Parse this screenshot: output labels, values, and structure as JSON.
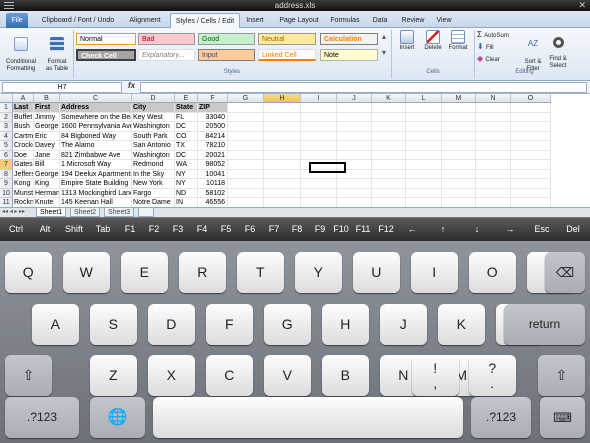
{
  "window": {
    "title": "address.xls"
  },
  "tabs": [
    "File",
    "Clipboard / Font / Undo",
    "Alignment",
    "Styles / Cells / Edit",
    "Insert",
    "Page Layout",
    "Formulas",
    "Data",
    "Review",
    "View"
  ],
  "ribbon": {
    "conditional": "Conditional\nFormatting",
    "format_table": "Format\nas Table",
    "styles": [
      "Normal",
      "Bad",
      "Good",
      "Neutral",
      "Calculation",
      "Check Cell",
      "Explanatory...",
      "Input",
      "Linked Cell",
      "Note"
    ],
    "styles_group": "Styles",
    "insert": "Insert",
    "delete": "Delete",
    "format": "Format",
    "cells_group": "Cells",
    "autosum": "AutoSum",
    "fill": "Fill",
    "clear": "Clear",
    "sort": "Sort &\nFilter",
    "find": "Find &\nSelect",
    "editing_group": "Editing"
  },
  "formula_bar": {
    "name_box": "H7",
    "fx": "fx",
    "value": ""
  },
  "grid": {
    "columns": [
      "A",
      "B",
      "C",
      "D",
      "E",
      "F",
      "G",
      "H",
      "I",
      "J",
      "K",
      "L",
      "M",
      "N",
      "O"
    ],
    "headers": [
      "Last",
      "First",
      "Address",
      "City",
      "State",
      "ZIP"
    ],
    "rows": [
      [
        "Buffet",
        "Jimmy",
        "Somewhere on the Beach",
        "Key West",
        "FL",
        "33040"
      ],
      [
        "Bush",
        "George",
        "1600 Pennsylvania Ave",
        "Washington",
        "DC",
        "20500"
      ],
      [
        "Cartman",
        "Eric",
        "84 Bigboned Way",
        "South Park",
        "CO",
        "84214"
      ],
      [
        "Crockett",
        "Davey",
        "The Alamo",
        "San Antonio",
        "TX",
        "78210"
      ],
      [
        "Doe",
        "Jane",
        "821 Zimbabwe Ave",
        "Washington",
        "DC",
        "20021"
      ],
      [
        "Gates",
        "Bill",
        "1 Microsoft Way",
        "Redmond",
        "WA",
        "98052"
      ],
      [
        "Jefferson",
        "George",
        "194 Deelux Apartments",
        "In the Sky",
        "NY",
        "10041"
      ],
      [
        "Kong",
        "King",
        "Empire State Building",
        "New York",
        "NY",
        "10118"
      ],
      [
        "Munster",
        "Herman",
        "1313 Mockingbird Lane",
        "Fargo",
        "ND",
        "58102"
      ],
      [
        "Rockne",
        "Knute",
        "145 Keenan Hall",
        "Notre Dame",
        "IN",
        "46556"
      ]
    ],
    "row_numbers": [
      "1",
      "2",
      "3",
      "4",
      "5",
      "6",
      "7",
      "8",
      "9",
      "10",
      "11"
    ]
  },
  "sheets": [
    "Sheet1",
    "Sheet2",
    "Sheet3"
  ],
  "fkeys": [
    "Ctrl",
    "Alt",
    "Shift",
    "Tab",
    "F1",
    "F2",
    "F3",
    "F4",
    "F5",
    "F6",
    "F7",
    "F8",
    "F9",
    "F10",
    "F11",
    "F12",
    "←",
    "↑",
    "↓",
    "→",
    "Esc",
    "Del"
  ],
  "keyboard": {
    "row1": [
      "Q",
      "W",
      "E",
      "R",
      "T",
      "Y",
      "U",
      "I",
      "O",
      "P"
    ],
    "row2": [
      "A",
      "S",
      "D",
      "F",
      "G",
      "H",
      "J",
      "K",
      "L"
    ],
    "return": "return",
    "row3": [
      "Z",
      "X",
      "C",
      "V",
      "B",
      "N",
      "M"
    ],
    "excl": {
      "top": "!",
      "bottom": ","
    },
    "quest": {
      "top": "?",
      "bottom": "."
    },
    "num": ".?123"
  }
}
